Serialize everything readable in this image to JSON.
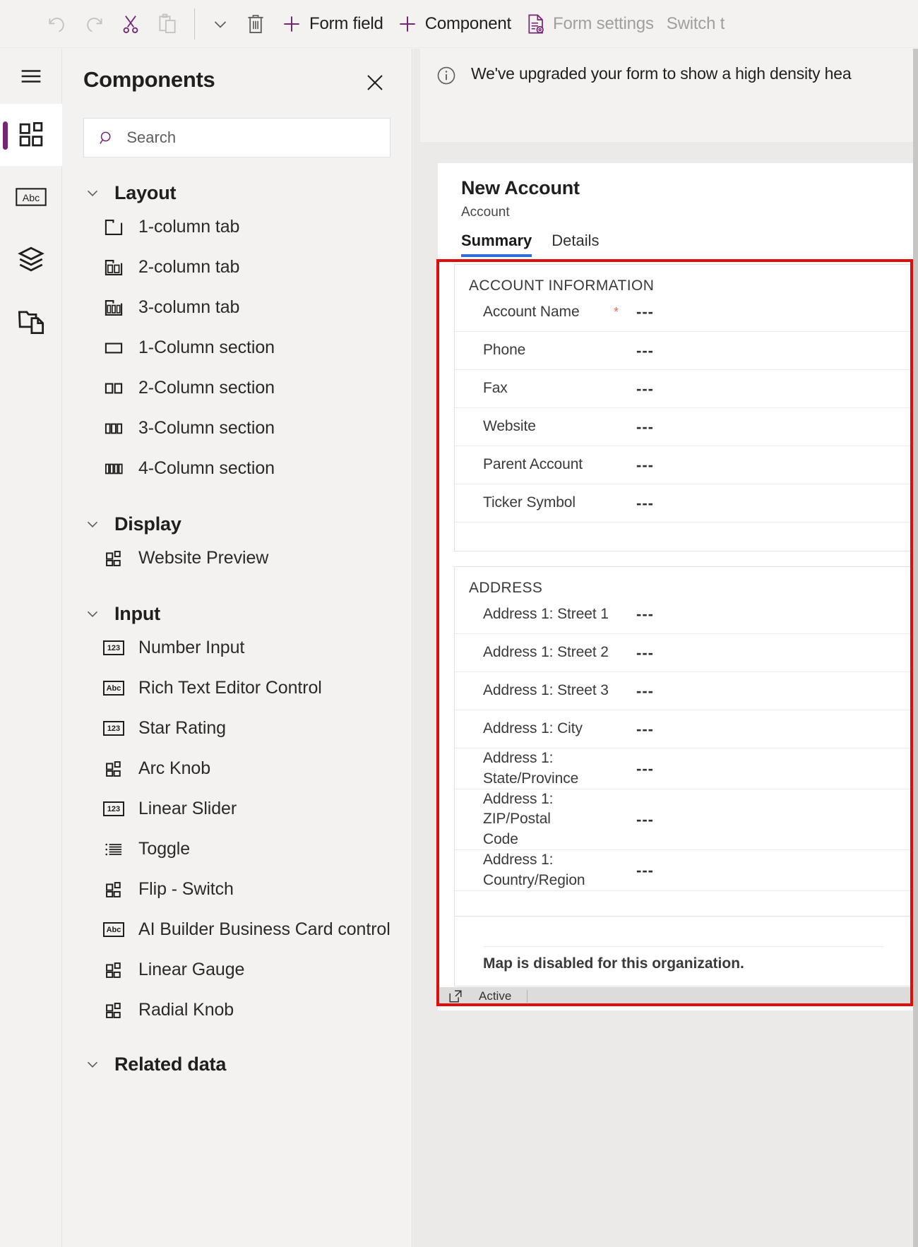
{
  "toolbar": {
    "items": [
      {
        "name": "undo",
        "icon": "undo-icon",
        "label": "",
        "disabled": true
      },
      {
        "name": "redo",
        "icon": "redo-icon",
        "label": "",
        "disabled": true
      },
      {
        "name": "cut",
        "icon": "cut-icon",
        "label": "",
        "disabled": false
      },
      {
        "name": "paste",
        "icon": "paste-icon",
        "label": "",
        "disabled": true
      },
      {
        "name": "overflow",
        "icon": "chevron-down-icon",
        "label": "",
        "disabled": false
      },
      {
        "name": "delete",
        "icon": "trash-icon",
        "label": "",
        "disabled": false
      }
    ],
    "form_field_label": "Form field",
    "component_label": "Component",
    "form_settings_label": "Form settings",
    "switch_label": "Switch t",
    "accent_color": "#742774",
    "disabled_color": "#a19f9d"
  },
  "rail": {
    "items": [
      {
        "name": "hamburger-icon",
        "tooltip": "Menu",
        "selected": false
      },
      {
        "name": "components-icon",
        "tooltip": "Components",
        "selected": true
      },
      {
        "name": "table-columns-icon",
        "tooltip": "Table columns",
        "selected": false
      },
      {
        "name": "layers-icon",
        "tooltip": "Tree view",
        "selected": false
      },
      {
        "name": "related-files-icon",
        "tooltip": "Related",
        "selected": false
      }
    ],
    "selected_indicator_color": "#742774"
  },
  "panel": {
    "title": "Components",
    "close_icon": "close-icon",
    "search": {
      "placeholder": "Search",
      "value": "",
      "icon": "search-icon"
    },
    "groups": [
      {
        "title": "Layout",
        "expanded": true,
        "items": [
          {
            "label": "1-column tab",
            "icon": "one-column-tab-icon"
          },
          {
            "label": "2-column tab",
            "icon": "two-column-tab-icon"
          },
          {
            "label": "3-column tab",
            "icon": "three-column-tab-icon"
          },
          {
            "label": "1-Column section",
            "icon": "one-column-section-icon"
          },
          {
            "label": "2-Column section",
            "icon": "two-column-section-icon"
          },
          {
            "label": "3-Column section",
            "icon": "three-column-section-icon"
          },
          {
            "label": "4-Column section",
            "icon": "four-column-section-icon"
          }
        ]
      },
      {
        "title": "Display",
        "expanded": true,
        "items": [
          {
            "label": "Website Preview",
            "icon": "component-blocks-icon"
          }
        ]
      },
      {
        "title": "Input",
        "expanded": true,
        "items": [
          {
            "label": "Number Input",
            "icon": "123-badge-icon"
          },
          {
            "label": "Rich Text Editor Control",
            "icon": "abc-badge-icon"
          },
          {
            "label": "Star Rating",
            "icon": "123-badge-icon"
          },
          {
            "label": "Arc Knob",
            "icon": "component-blocks-icon"
          },
          {
            "label": "Linear Slider",
            "icon": "123-badge-icon"
          },
          {
            "label": "Toggle",
            "icon": "list-icon"
          },
          {
            "label": "Flip - Switch",
            "icon": "component-blocks-icon"
          },
          {
            "label": "AI Builder Business Card control",
            "icon": "abc-badge-icon"
          },
          {
            "label": "Linear Gauge",
            "icon": "component-blocks-icon"
          },
          {
            "label": "Radial Knob",
            "icon": "component-blocks-icon"
          }
        ]
      },
      {
        "title": "Related data",
        "expanded": true,
        "items": []
      }
    ]
  },
  "canvas": {
    "notice": {
      "icon": "info-icon",
      "text": "We've upgraded your form to show a high density hea"
    },
    "form": {
      "title": "New Account",
      "subtitle": "Account",
      "tabs": [
        {
          "label": "Summary",
          "active": true
        },
        {
          "label": "Details",
          "active": false
        }
      ],
      "active_tab_underline_color": "#2d6fd4",
      "sections": [
        {
          "header": "ACCOUNT INFORMATION",
          "fields": [
            {
              "label": "Account Name",
              "required": true,
              "value": "---"
            },
            {
              "label": "Phone",
              "required": false,
              "value": "---"
            },
            {
              "label": "Fax",
              "required": false,
              "value": "---"
            },
            {
              "label": "Website",
              "required": false,
              "value": "---"
            },
            {
              "label": "Parent Account",
              "required": false,
              "value": "---"
            },
            {
              "label": "Ticker Symbol",
              "required": false,
              "value": "---"
            }
          ]
        },
        {
          "header": "ADDRESS",
          "fields": [
            {
              "label": "Address 1: Street 1",
              "required": false,
              "value": "---"
            },
            {
              "label": "Address 1: Street 2",
              "required": false,
              "value": "---"
            },
            {
              "label": "Address 1: Street 3",
              "required": false,
              "value": "---"
            },
            {
              "label": "Address 1: City",
              "required": false,
              "value": "---"
            },
            {
              "label": "Address 1: State/Province",
              "required": false,
              "value": "---"
            },
            {
              "label": "Address 1: ZIP/Postal Code",
              "required": false,
              "value": "---"
            },
            {
              "label": "Address 1: Country/Region",
              "required": false,
              "value": "---"
            }
          ]
        }
      ],
      "map_message": "Map is disabled for this organization.",
      "status": {
        "icon": "popout-icon",
        "text": "Active"
      }
    },
    "selection_highlight_color": "#e10c0c",
    "required_marker_color": "#e8705a"
  }
}
